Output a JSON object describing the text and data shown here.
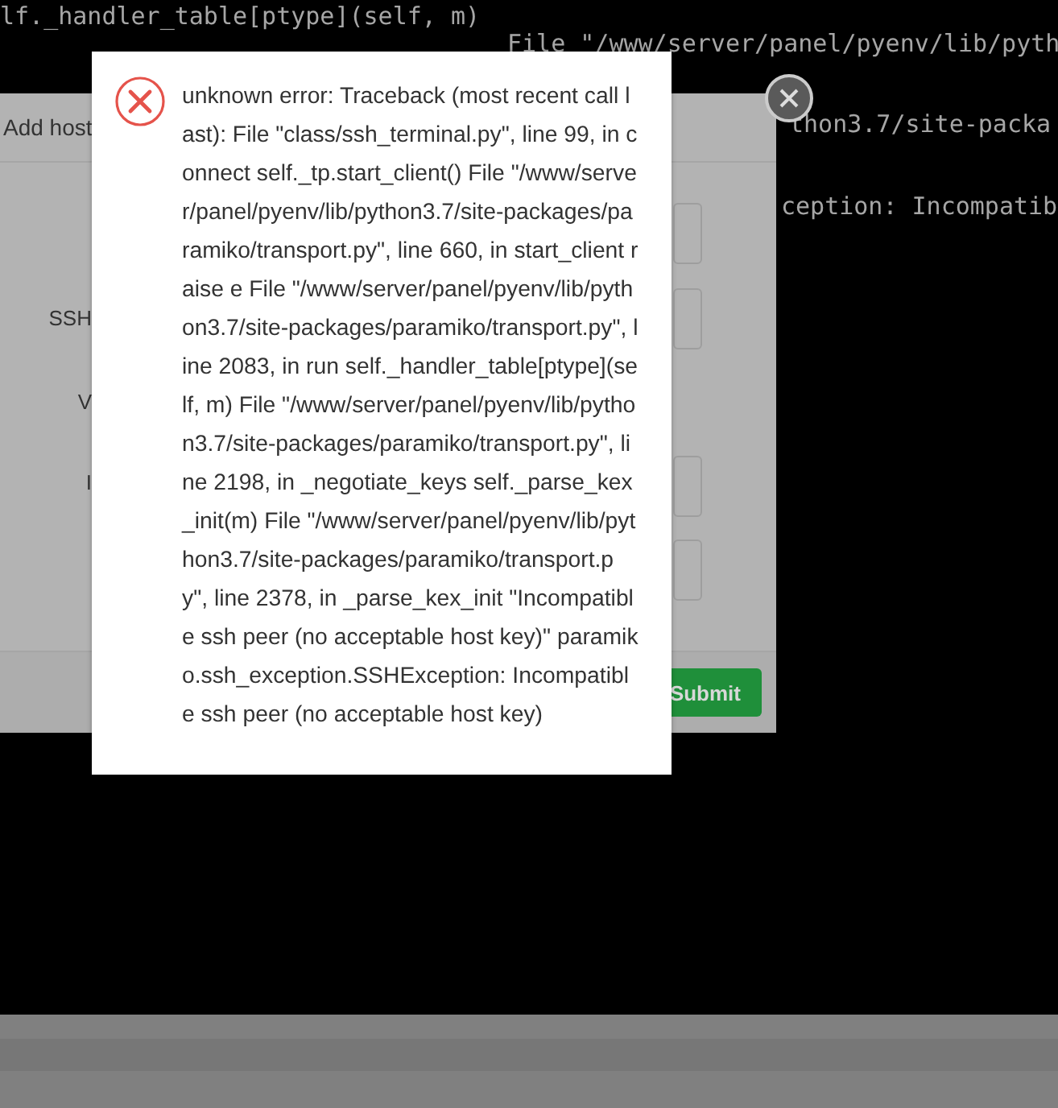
{
  "terminal": {
    "lines": [
      "lf._handler_table[ptype](self, m)",
      "File \"/www/server/panel/pyenv/lib/pyth",
      "thon3.7/site-packa",
      "ception: Incompatib"
    ]
  },
  "add_host_dialog": {
    "title": "Add host",
    "labels": [
      "SSH",
      "V",
      "I"
    ],
    "submit": "Submit"
  },
  "error_dialog": {
    "message": "unknown error: Traceback (most recent call last): File \"class/ssh_terminal.py\", line 99, in connect self._tp.start_client() File \"/www/server/panel/pyenv/lib/python3.7/site-packages/paramiko/transport.py\", line 660, in start_client raise e File \"/www/server/panel/pyenv/lib/python3.7/site-packages/paramiko/transport.py\", line 2083, in run self._handler_table[ptype](self, m) File \"/www/server/panel/pyenv/lib/python3.7/site-packages/paramiko/transport.py\", line 2198, in _negotiate_keys self._parse_kex_init(m) File \"/www/server/panel/pyenv/lib/python3.7/site-packages/paramiko/transport.py\", line 2378, in _parse_kex_init \"Incompatible ssh peer (no acceptable host key)\" paramiko.ssh_exception.SSHException: Incompatible ssh peer (no acceptable host key)"
  }
}
